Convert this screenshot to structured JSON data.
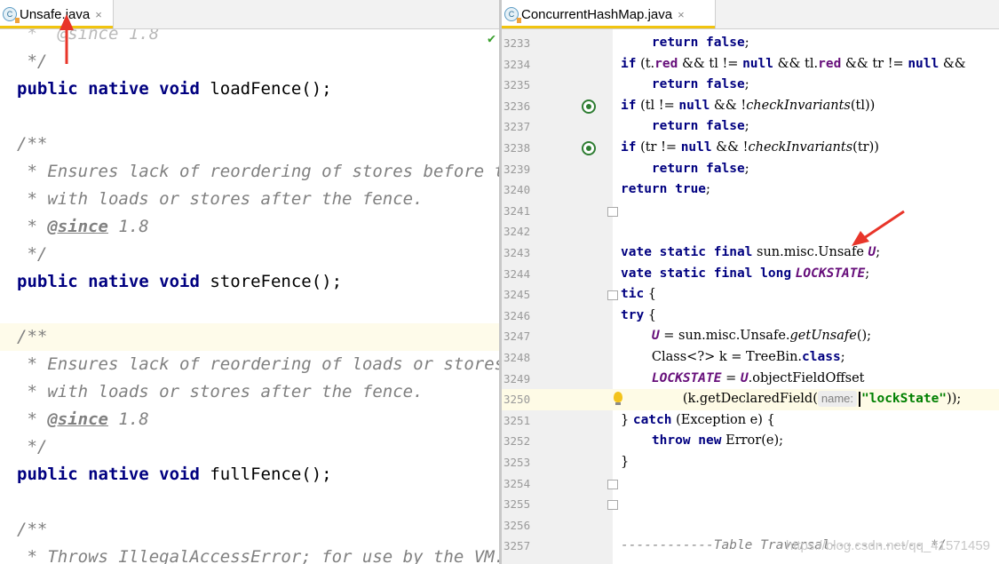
{
  "accent_color": "#f1c40f",
  "left_pane": {
    "tab": {
      "icon": "java-class-icon",
      "icon_letter": "C",
      "label": "Unsafe.java",
      "close": "×"
    },
    "status_icon": "✔",
    "lines": [
      {
        "text": " *  @since 1.8",
        "style": "cut"
      },
      {
        "text": " */",
        "style": "cm"
      },
      {
        "kw": "public native void",
        "rest": " loadFence();"
      },
      {
        "text": "",
        "style": "plain"
      },
      {
        "text": "/**",
        "style": "cm"
      },
      {
        "text": " * Ensures lack of reordering of stores before the",
        "style": "cm"
      },
      {
        "text": " * with loads or stores after the fence.",
        "style": "cm"
      },
      {
        "pre": " * ",
        "tag": "@since",
        "post": " 1.8"
      },
      {
        "text": " */",
        "style": "cm"
      },
      {
        "kw": "public native void",
        "rest": " storeFence();"
      },
      {
        "text": "",
        "style": "plain"
      },
      {
        "text": "/**",
        "style": "cm",
        "highlight": true
      },
      {
        "text": " * Ensures lack of reordering of loads or stores b",
        "style": "cm"
      },
      {
        "text": " * with loads or stores after the fence.",
        "style": "cm"
      },
      {
        "pre": " * ",
        "tag": "@since",
        "post": " 1.8"
      },
      {
        "text": " */",
        "style": "cm"
      },
      {
        "kw": "public native void",
        "rest": " fullFence();"
      },
      {
        "text": "",
        "style": "plain"
      },
      {
        "text": "/**",
        "style": "cm"
      },
      {
        "text": " * Throws IllegalAccessError; for use by the VM.",
        "style": "cm"
      }
    ]
  },
  "right_pane": {
    "tab": {
      "icon": "java-class-icon",
      "icon_letter": "C",
      "label": "ConcurrentHashMap.java",
      "close": "×"
    },
    "line_numbers": [
      "3233",
      "3234",
      "3235",
      "3236",
      "3237",
      "3238",
      "3239",
      "3240",
      "3241",
      "3242",
      "3243",
      "3244",
      "3245",
      "3246",
      "3247",
      "3248",
      "3249",
      "3250",
      "3251",
      "3252",
      "3253",
      "3254",
      "3255",
      "3256",
      "3257"
    ],
    "lines": [
      [
        {
          "t": "    "
        },
        {
          "t": "return false",
          "c": "kw"
        },
        {
          "t": ";",
          "c": "ser"
        }
      ],
      [
        {
          "t": "if",
          "c": "kw"
        },
        {
          "t": " (t.",
          "c": "ser"
        },
        {
          "t": "red",
          "c": "fld"
        },
        {
          "t": " && tl != ",
          "c": "ser"
        },
        {
          "t": "null",
          "c": "kw"
        },
        {
          "t": " && tl.",
          "c": "ser"
        },
        {
          "t": "red",
          "c": "fld"
        },
        {
          "t": " && tr != ",
          "c": "ser"
        },
        {
          "t": "null",
          "c": "kw"
        },
        {
          "t": " &&",
          "c": "ser"
        }
      ],
      [
        {
          "t": "    "
        },
        {
          "t": "return false",
          "c": "kw"
        },
        {
          "t": ";",
          "c": "ser"
        }
      ],
      [
        {
          "t": "if",
          "c": "kw"
        },
        {
          "t": " (tl != ",
          "c": "ser"
        },
        {
          "t": "null",
          "c": "kw"
        },
        {
          "t": " && !",
          "c": "ser"
        },
        {
          "t": "checkInvariants",
          "c": "ser mth"
        },
        {
          "t": "(tl))",
          "c": "ser"
        }
      ],
      [
        {
          "t": "    "
        },
        {
          "t": "return false",
          "c": "kw"
        },
        {
          "t": ";",
          "c": "ser"
        }
      ],
      [
        {
          "t": "if",
          "c": "kw"
        },
        {
          "t": " (tr != ",
          "c": "ser"
        },
        {
          "t": "null",
          "c": "kw"
        },
        {
          "t": " && !",
          "c": "ser"
        },
        {
          "t": "checkInvariants",
          "c": "ser mth"
        },
        {
          "t": "(tr))",
          "c": "ser"
        }
      ],
      [
        {
          "t": "    "
        },
        {
          "t": "return false",
          "c": "kw"
        },
        {
          "t": ";",
          "c": "ser"
        }
      ],
      [
        {
          "t": "return true",
          "c": "kw"
        },
        {
          "t": ";",
          "c": "ser"
        }
      ],
      [],
      [],
      [
        {
          "t": "vate static final",
          "c": "kw"
        },
        {
          "t": " sun.misc.Unsafe ",
          "c": "ser"
        },
        {
          "t": "U",
          "c": "sfld"
        },
        {
          "t": ";",
          "c": "ser"
        }
      ],
      [
        {
          "t": "vate static final long",
          "c": "kw"
        },
        {
          "t": " ",
          "c": "ser"
        },
        {
          "t": "LOCKSTATE",
          "c": "sfld"
        },
        {
          "t": ";",
          "c": "ser"
        }
      ],
      [
        {
          "t": "tic",
          "c": "kw"
        },
        {
          "t": " {",
          "c": "ser"
        }
      ],
      [
        {
          "t": "try",
          "c": "kw"
        },
        {
          "t": " {",
          "c": "ser"
        }
      ],
      [
        {
          "t": "    "
        },
        {
          "t": "U",
          "c": "sfld"
        },
        {
          "t": " = sun.misc.Unsafe.",
          "c": "ser"
        },
        {
          "t": "getUnsafe",
          "c": "ser mth"
        },
        {
          "t": "();",
          "c": "ser"
        }
      ],
      [
        {
          "t": "    "
        },
        {
          "t": "Class<?> k = TreeBin.",
          "c": "ser"
        },
        {
          "t": "class",
          "c": "kw"
        },
        {
          "t": ";",
          "c": "ser"
        }
      ],
      [
        {
          "t": "    "
        },
        {
          "t": "LOCKSTATE",
          "c": "sfld"
        },
        {
          "t": " = ",
          "c": "ser"
        },
        {
          "t": "U",
          "c": "sfld"
        },
        {
          "t": ".objectFieldOffset",
          "c": "ser"
        }
      ],
      [
        {
          "t": "        "
        },
        {
          "t": "(k.getDeclaredField(",
          "c": "ser"
        },
        {
          "t": "name:",
          "c": "hint"
        },
        {
          "t": "",
          "c": "caret"
        },
        {
          "t": "\"lockState\"",
          "c": "str"
        },
        {
          "t": "));",
          "c": "ser"
        }
      ],
      [
        {
          "t": "} ",
          "c": "ser"
        },
        {
          "t": "catch",
          "c": "kw"
        },
        {
          "t": " (Exception e) {",
          "c": "ser"
        }
      ],
      [
        {
          "t": "    "
        },
        {
          "t": "throw new",
          "c": "kw"
        },
        {
          "t": " Error(e);",
          "c": "ser"
        }
      ],
      [
        {
          "t": "}",
          "c": "ser"
        }
      ],
      [],
      [],
      [],
      [
        {
          "t": "------------Table Traversal------------ */",
          "c": "cm"
        }
      ]
    ],
    "current_line": "3250",
    "gutter_markers": [
      {
        "line": "3236",
        "icon": "override-method-icon"
      },
      {
        "line": "3238",
        "icon": "override-method-icon"
      },
      {
        "line": "3241",
        "icon": "fold-end-icon"
      },
      {
        "line": "3245",
        "icon": "fold-start-icon"
      },
      {
        "line": "3250",
        "icon": "intention-bulb-icon"
      },
      {
        "line": "3254",
        "icon": "fold-end-icon"
      },
      {
        "line": "3255",
        "icon": "fold-end-icon"
      }
    ]
  },
  "watermark": "https://blog.csdn.net/qq_41571459"
}
